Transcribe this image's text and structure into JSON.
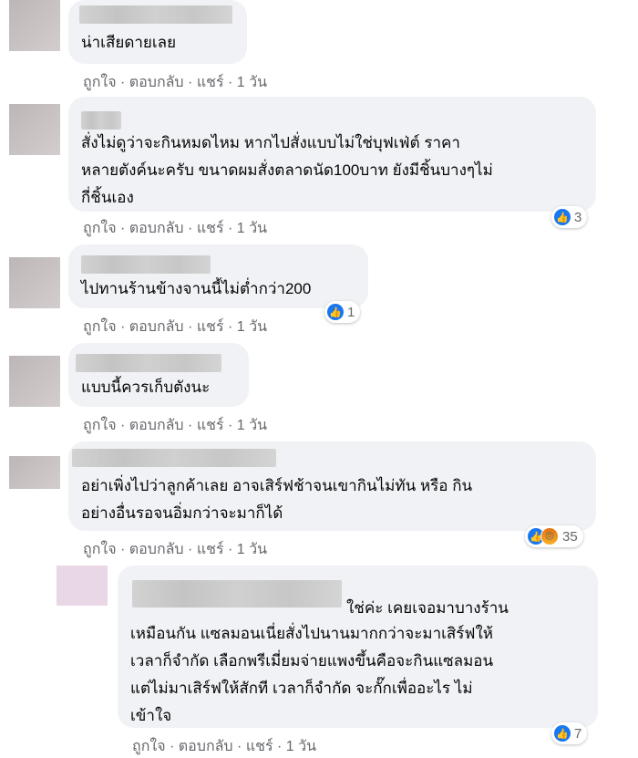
{
  "comments": [
    {
      "text": "น่าเสียดายเลย",
      "actions": {
        "like": "ถูกใจ",
        "reply": "ตอบกลับ",
        "share": "แชร์",
        "time": "1 วัน"
      }
    },
    {
      "text": "สั่งไม่ดูว่าจะกินหมดไหม หากไปสั่งแบบไม่ใช่บุฟเฟ่ต์ ราคา\nหลายตังค์นะครับ ขนาดผมสั่งตลาดนัด100บาท ยังมีชิ้นบางๆไม่\nกี่ชิ้นเอง",
      "actions": {
        "like": "ถูกใจ",
        "reply": "ตอบกลับ",
        "share": "แชร์",
        "time": "1 วัน"
      },
      "reactions": {
        "count": "3",
        "types": [
          "like-icon"
        ]
      }
    },
    {
      "text": "ไปทานร้านข้างจานนี้ไม่ต่ำกว่า200",
      "actions": {
        "like": "ถูกใจ",
        "reply": "ตอบกลับ",
        "share": "แชร์",
        "time": "1 วัน"
      },
      "reactions": {
        "count": "1",
        "types": [
          "like-icon"
        ]
      }
    },
    {
      "text": "แบบนี้ควรเก็บตังนะ",
      "actions": {
        "like": "ถูกใจ",
        "reply": "ตอบกลับ",
        "share": "แชร์",
        "time": "1 วัน"
      }
    },
    {
      "text": "อย่าเพิ่งไปว่าลูกค้าเลย อาจเสิร์ฟช้าจนเขากินไม่ทัน หรือ กิน\nอย่างอื่นรอจนอิ่มกว่าจะมาก็ได้",
      "actions": {
        "like": "ถูกใจ",
        "reply": "ตอบกลับ",
        "share": "แชร์",
        "time": "1 วัน"
      },
      "reactions": {
        "count": "35",
        "types": [
          "like-icon",
          "angry-icon"
        ]
      }
    }
  ],
  "reply": {
    "text_first": "ใช่ค่ะ เคยเจอมาบางร้าน",
    "text_rest": "เหมือนกัน แซลมอนเนี่ยสั่งไปนานมากกว่าจะมาเสิร์ฟให้\nเวลาก็จำกัด เลือกพรีเมี่ยมจ่ายแพงขึ้นคือจะกินแซลมอน\nแต่ไม่มาเสิร์ฟให้สักที เวลาก็จำกัด จะกั๊กเพื่ออะไร ไม่\nเข้าใจ",
    "actions": {
      "like": "ถูกใจ",
      "reply": "ตอบกลับ",
      "share": "แชร์",
      "time": "1 วัน"
    },
    "reactions": {
      "count": "7",
      "types": [
        "like-icon"
      ]
    }
  },
  "separator": " · ",
  "colors": {
    "like": "#1877f2",
    "bubble": "#f0f2f5",
    "meta": "#65676b"
  }
}
